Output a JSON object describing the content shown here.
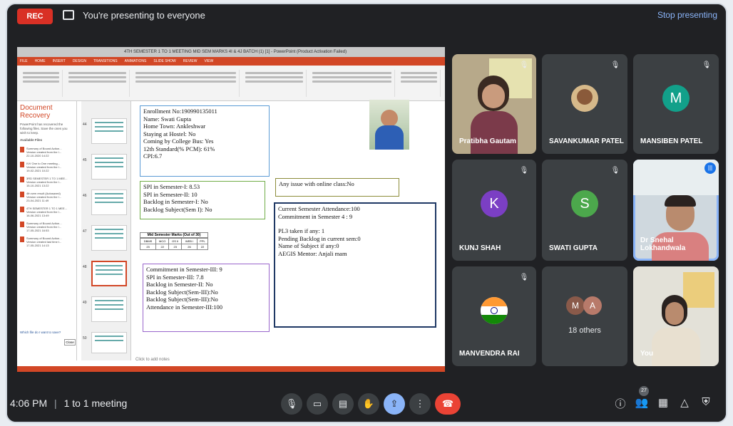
{
  "top_bar": {
    "rec_label": "REC",
    "presenting_text": "You're presenting to everyone",
    "stop_label": "Stop presenting"
  },
  "presentation": {
    "window_title": "4TH SEMESTER 1 TO 1 MEETING MID SEM MARKS 4I & 4J BATCH (1) [1] - PowerPoint (Product Activation Failed)",
    "ribbon_tabs": [
      "FILE",
      "HOME",
      "INSERT",
      "DESIGN",
      "TRANSITIONS",
      "ANIMATIONS",
      "SLIDE SHOW",
      "REVIEW",
      "VIEW"
    ],
    "recovery": {
      "title": "Document Recovery",
      "description": "PowerPoint has recovered the following files. Save the ones you wish to keep.",
      "available": "Available Files",
      "files": [
        {
          "name": "Summary of Bound Action...",
          "info": "Version created from the l...",
          "date": "22-10-2020 14:22"
        },
        {
          "name": "IVV One to One meeting...",
          "info": "Version created from the l...",
          "date": "19-02-2021 10:22"
        },
        {
          "name": "3RD SEMESTER 1 TO 1 MEE...",
          "info": "Version created from the l...",
          "date": "15-10-2021 13:22"
        },
        {
          "name": "4th sem result (Autosaved)",
          "info": "Version created from the l...",
          "date": "23-04-2021 11:49"
        },
        {
          "name": "4TH SEMESTER 1 TO 1 MEE...",
          "info": "Version created from the l...",
          "date": "16-06-2021 13:49"
        },
        {
          "name": "Summary of Bound Action...",
          "info": "Version created from the l...",
          "date": "17-05-2021 16:53"
        },
        {
          "name": "Summary of Bound Action...",
          "info": "Version created last time t...",
          "date": "17-05-2021 14:13"
        }
      ],
      "which_files": "Which file do I want to save?",
      "close_label": "Close"
    },
    "thumb_numbers": [
      "44",
      "45",
      "46",
      "47",
      "48",
      "49",
      "50"
    ],
    "slide": {
      "info_box": [
        "Enrollment No:190990135011",
        "Name: Swati Gupta",
        "Home Town: Ankleshwar",
        "Staying at Hostel: No",
        "Coming by College Bus: Yes",
        "12th Standard(% PCM): 61%",
        "CPI:6.7"
      ],
      "spi_box": [
        "SPI in Semester-I: 8.53",
        "SPI in Semester-II: 10",
        "Backlog in Semester-I: No",
        "Backlog Subject(Sem I): No"
      ],
      "online_issue": "Any issue with online class:No",
      "marks_title": "Mid Semester Marks (Out of 30)",
      "marks_headers": [
        "DBMS",
        "MCO",
        "OS II",
        "WEB I",
        "PPL"
      ],
      "marks_values": [
        "23",
        "22",
        "23",
        "26",
        "22"
      ],
      "sem3_box": [
        "Commitment in Semester-III: 9",
        "SPI in Semester-III: 7.8",
        "Backlog in Semester-II: No",
        "Backlog Subject(Sem-III):No",
        "Backlog Subject(Sem-III):No",
        "Attendance in Semester-III:100"
      ],
      "current_box": [
        "Current Semester Attendance:100",
        "Commitment in Semester 4 : 9",
        "",
        "PL3 taken if any: 1",
        "Pending Backlog in current sem:0",
        "Name of Subject if any:0",
        "AEGIS Mentor: Anjali mam"
      ]
    },
    "notes_placeholder": "Click to add notes"
  },
  "participants": [
    {
      "name": "Pratibha Gautam",
      "type": "video"
    },
    {
      "name": "SAVANKUMAR PATEL",
      "type": "photo"
    },
    {
      "name": "MANSIBEN PATEL",
      "type": "avatar",
      "initial": "M",
      "color": "#12a08a"
    },
    {
      "name": "KUNJ SHAH",
      "type": "avatar",
      "initial": "K",
      "color": "#7b3fc4"
    },
    {
      "name": "SWATI GUPTA",
      "type": "avatar",
      "initial": "S",
      "color": "#4ca84c"
    },
    {
      "name": "Dr Snehal Lokhandwala",
      "type": "video"
    },
    {
      "name": "MANVENDRA RAI",
      "type": "flag"
    },
    {
      "name": "18 others",
      "type": "group",
      "initials": [
        "M",
        "A"
      ]
    },
    {
      "name": "You",
      "type": "video"
    }
  ],
  "bottom_bar": {
    "time": "4:06 PM",
    "meeting_name": "1 to 1 meeting",
    "participant_count": "27"
  }
}
